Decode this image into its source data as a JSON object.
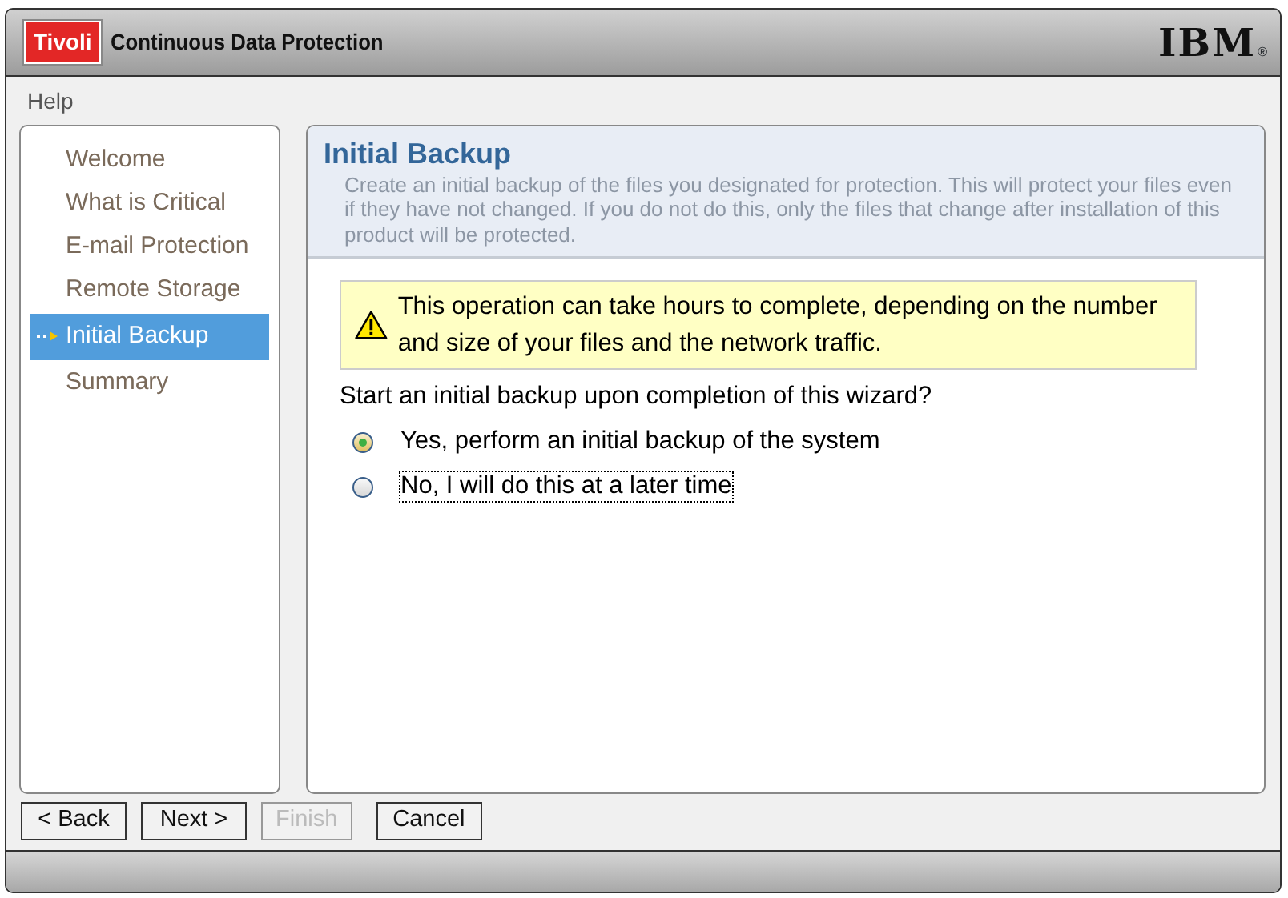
{
  "header": {
    "brand": "Tivoli",
    "title": "Continuous Data Protection",
    "logo": "IBM",
    "logo_mark": "®"
  },
  "menu": [
    "Help"
  ],
  "steps": [
    {
      "label": "Welcome",
      "selected": false
    },
    {
      "label": "What is Critical",
      "selected": false
    },
    {
      "label": "E-mail Protection",
      "selected": false
    },
    {
      "label": "Remote Storage",
      "selected": false
    },
    {
      "label": "Initial Backup",
      "selected": true
    },
    {
      "label": "Summary",
      "selected": false
    }
  ],
  "page": {
    "title": "Initial Backup",
    "description": "Create an initial backup of the files you designated for protection. This will protect your files even if they have not changed. If you do not do this, only the files that change after installation of this product will be protected.",
    "warning": "This operation can take hours to complete, depending on the number and size of your files and the network traffic.",
    "question": "Start an initial backup upon completion of this wizard?",
    "options": [
      {
        "label": "Yes, perform an initial backup of the system",
        "selected": true,
        "focused": false
      },
      {
        "label": "No, I will do this at a later time",
        "selected": false,
        "focused": true
      }
    ]
  },
  "buttons": [
    {
      "label": "< Back",
      "disabled": false
    },
    {
      "label": "Next >",
      "disabled": false
    },
    {
      "label": "Finish",
      "disabled": true
    },
    {
      "label": "Cancel",
      "disabled": false
    }
  ]
}
